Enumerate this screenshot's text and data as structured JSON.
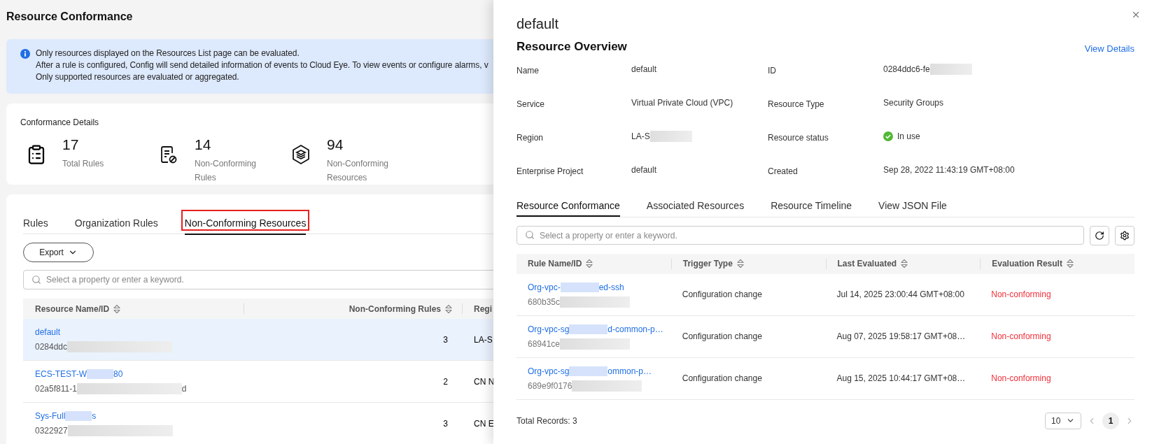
{
  "page": {
    "title": "Resource Conformance"
  },
  "notice": {
    "lines": [
      "Only resources displayed on the Resources List page can be evaluated.",
      "After a rule is configured, Config will send detailed information of events to Cloud Eye. To view events or configure alarms, v",
      "Only supported resources are evaluated or aggregated."
    ]
  },
  "conformance_details": {
    "title": "Conformance Details",
    "stats": [
      {
        "kind": "rules",
        "value": "17",
        "label": "Total Rules"
      },
      {
        "kind": "nonconforming_rules",
        "value": "14",
        "label": "Non-Conforming Rules"
      },
      {
        "kind": "resources",
        "value": "94",
        "label": "Non-Conforming Resources"
      }
    ]
  },
  "tabs": [
    {
      "label": "Rules",
      "selected": false,
      "highlighted": false
    },
    {
      "label": "Organization Rules",
      "selected": false,
      "highlighted": false
    },
    {
      "label": "Non-Conforming Resources",
      "selected": true,
      "highlighted": true
    }
  ],
  "export_button": "Export",
  "search": {
    "placeholder": "Select a property or enter a keyword."
  },
  "table": {
    "columns": [
      {
        "label": "Resource Name/ID",
        "sortable": true
      },
      {
        "label": "Non-Conforming Rules",
        "sortable": true
      },
      {
        "label": "Regi",
        "sortable": false
      }
    ],
    "rows": [
      {
        "selected": true,
        "name": [
          {
            "kind": "text",
            "text": "default"
          }
        ],
        "id": [
          {
            "kind": "text",
            "text": "0284ddc"
          },
          {
            "kind": "redacted"
          }
        ],
        "count": "3",
        "region": "LA-S"
      },
      {
        "selected": false,
        "name": [
          {
            "kind": "text",
            "text": "ECS-TEST-W"
          },
          {
            "kind": "redacted"
          },
          {
            "kind": "text",
            "text": "80"
          }
        ],
        "id": [
          {
            "kind": "text",
            "text": "02a5f811-1"
          },
          {
            "kind": "redacted"
          },
          {
            "kind": "text",
            "text": "d"
          }
        ],
        "count": "2",
        "region": "CN N"
      },
      {
        "selected": false,
        "name": [
          {
            "kind": "text",
            "text": "Sys-Full"
          },
          {
            "kind": "redacted"
          },
          {
            "kind": "text",
            "text": "s"
          }
        ],
        "id": [
          {
            "kind": "text",
            "text": "0322927"
          },
          {
            "kind": "redacted"
          }
        ],
        "count": "3",
        "region": "CN E"
      }
    ]
  },
  "drawer": {
    "title": "default",
    "section_title": "Resource Overview",
    "view_details": "View Details",
    "fields": [
      {
        "label": "Name",
        "value": [
          {
            "kind": "text",
            "text": "default"
          }
        ]
      },
      {
        "label": "ID",
        "value": [
          {
            "kind": "text",
            "text": "0284ddc6-fe"
          },
          {
            "kind": "redacted"
          }
        ]
      },
      {
        "label": "Service",
        "value": [
          {
            "kind": "text",
            "text": "Virtual Private Cloud (VPC)"
          }
        ]
      },
      {
        "label": "Resource Type",
        "value": [
          {
            "kind": "text",
            "text": "Security Groups"
          }
        ]
      },
      {
        "label": "Region",
        "value": [
          {
            "kind": "text",
            "text": "LA-S"
          },
          {
            "kind": "redacted"
          }
        ]
      },
      {
        "label": "Resource status",
        "value": [
          {
            "kind": "status_ok"
          },
          {
            "kind": "text",
            "text": "In use"
          }
        ]
      },
      {
        "label": "Enterprise Project",
        "value": [
          {
            "kind": "text",
            "text": "default"
          }
        ]
      },
      {
        "label": "Created",
        "value": [
          {
            "kind": "text",
            "text": "Sep 28, 2022 11:43:19 GMT+08:00"
          }
        ]
      }
    ],
    "tabs": [
      {
        "label": "Resource Conformance",
        "selected": true
      },
      {
        "label": "Associated Resources",
        "selected": false
      },
      {
        "label": "Resource Timeline",
        "selected": false
      },
      {
        "label": "View JSON File",
        "selected": false
      }
    ],
    "search": {
      "placeholder": "Select a property or enter a keyword."
    },
    "table": {
      "columns": [
        {
          "label": "Rule Name/ID",
          "sortable": true
        },
        {
          "label": "Trigger Type",
          "sortable": true
        },
        {
          "label": "Last Evaluated",
          "sortable": true
        },
        {
          "label": "Evaluation Result",
          "sortable": true
        }
      ],
      "rows": [
        {
          "name": [
            {
              "kind": "text",
              "text": "Org-vpc-"
            },
            {
              "kind": "redacted"
            },
            {
              "kind": "text",
              "text": "ed-ssh"
            }
          ],
          "id": [
            {
              "kind": "text",
              "text": "680b35c"
            },
            {
              "kind": "redacted"
            }
          ],
          "trigger": "Configuration change",
          "last_evaluated": "Jul 14, 2025 23:00:44 GMT+08:00",
          "result": "Non-conforming",
          "conforming": false
        },
        {
          "name": [
            {
              "kind": "text",
              "text": "Org-vpc-sg"
            },
            {
              "kind": "redacted"
            },
            {
              "kind": "text",
              "text": "d-common-p…"
            }
          ],
          "id": [
            {
              "kind": "text",
              "text": "68941ce"
            },
            {
              "kind": "redacted"
            }
          ],
          "trigger": "Configuration change",
          "last_evaluated": "Aug 07, 2025 19:58:17 GMT+08…",
          "result": "Non-conforming",
          "conforming": false
        },
        {
          "name": [
            {
              "kind": "text",
              "text": "Org-vpc-sg"
            },
            {
              "kind": "redacted"
            },
            {
              "kind": "text",
              "text": "ommon-p…"
            }
          ],
          "id": [
            {
              "kind": "text",
              "text": "689e9f0176"
            },
            {
              "kind": "redacted"
            }
          ],
          "trigger": "Configuration change",
          "last_evaluated": "Aug 15, 2025 10:44:17 GMT+08…",
          "result": "Non-conforming",
          "conforming": false
        }
      ]
    },
    "footer": {
      "total": "Total Records: 3",
      "page_size": "10",
      "pages": [
        {
          "label": "1",
          "selected": true
        }
      ]
    }
  }
}
